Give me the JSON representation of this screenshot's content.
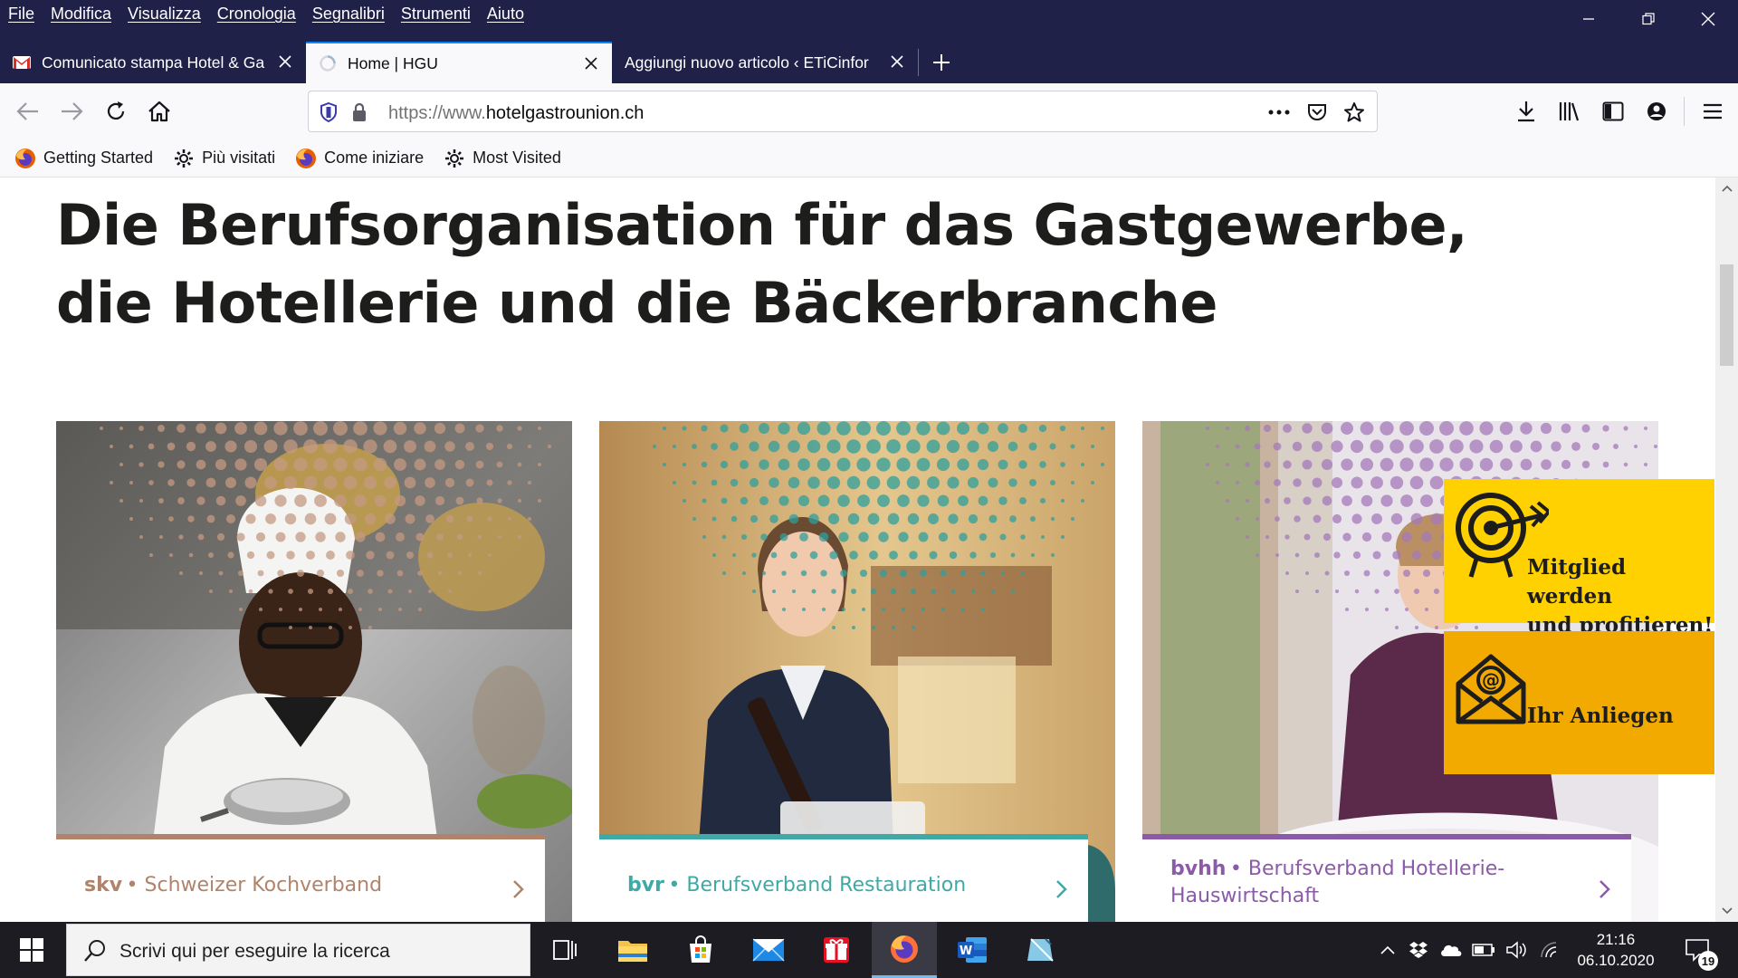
{
  "menu": [
    "File",
    "Modifica",
    "Visualizza",
    "Cronologia",
    "Segnalibri",
    "Strumenti",
    "Aiuto"
  ],
  "tabs": [
    {
      "label": "Comunicato stampa Hotel & Ga",
      "icon": "gmail-icon"
    },
    {
      "label": "Home | HGU",
      "icon": "loading-icon"
    },
    {
      "label": "Aggiungi nuovo articolo ‹ ETiCinfor",
      "icon": "none"
    }
  ],
  "url": {
    "prefix": "https://www.",
    "domain": "hotelgastrounion.ch"
  },
  "bookmarks": [
    {
      "label": "Getting Started",
      "icon": "firefox-icon"
    },
    {
      "label": "Più visitati",
      "icon": "gear-icon"
    },
    {
      "label": "Come iniziare",
      "icon": "firefox-icon"
    },
    {
      "label": "Most Visited",
      "icon": "gear-icon"
    }
  ],
  "page": {
    "headline_line1": "Die Berufsorganisation für das Gastgewerbe,",
    "headline_line2": "die Hotellerie und die Bäckerbranche",
    "cards": [
      {
        "abbr": "skv",
        "name": "Schweizer Kochverband",
        "color": "#b0836a"
      },
      {
        "abbr": "bvr",
        "name": "Berufsverband Restauration",
        "color": "#3ea9a6"
      },
      {
        "abbr": "bvhh",
        "name": "Berufsverband Hotellerie-Hauswirtschaft",
        "name_line1": "Berufsverband Hotellerie-",
        "name_line2": "Hauswirtschaft",
        "color": "#8b5aa8"
      }
    ],
    "cta_member": {
      "line1": "Mitglied werden",
      "line2": "und profitieren!",
      "color": "#ffd100"
    },
    "cta_contact": {
      "label": "Ihr Anliegen",
      "color": "#f2a900"
    }
  },
  "taskbar": {
    "search_placeholder": "Scrivi qui per eseguire la ricerca",
    "time": "21:16",
    "date": "06.10.2020",
    "notifications": "19"
  }
}
